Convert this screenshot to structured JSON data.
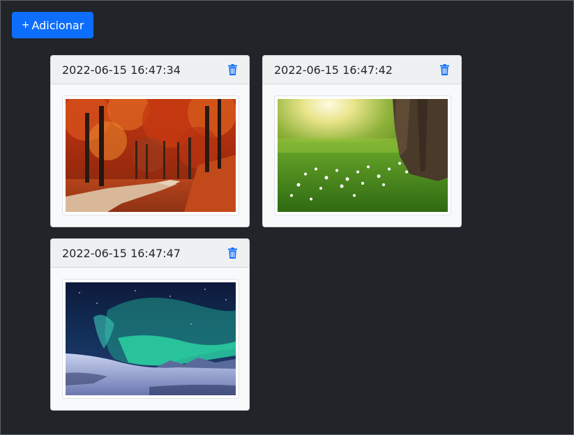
{
  "toolbar": {
    "add_icon": "+",
    "add_label": "Adicionar"
  },
  "cards": [
    {
      "timestamp": "2022-06-15 16:47:34",
      "image": "autumn-forest-path"
    },
    {
      "timestamp": "2022-06-15 16:47:42",
      "image": "sunny-meadow-tree"
    },
    {
      "timestamp": "2022-06-15 16:47:47",
      "image": "northern-lights"
    }
  ],
  "colors": {
    "background": "#212529",
    "primary": "#0d6efd",
    "card": "#f8f9fa"
  }
}
